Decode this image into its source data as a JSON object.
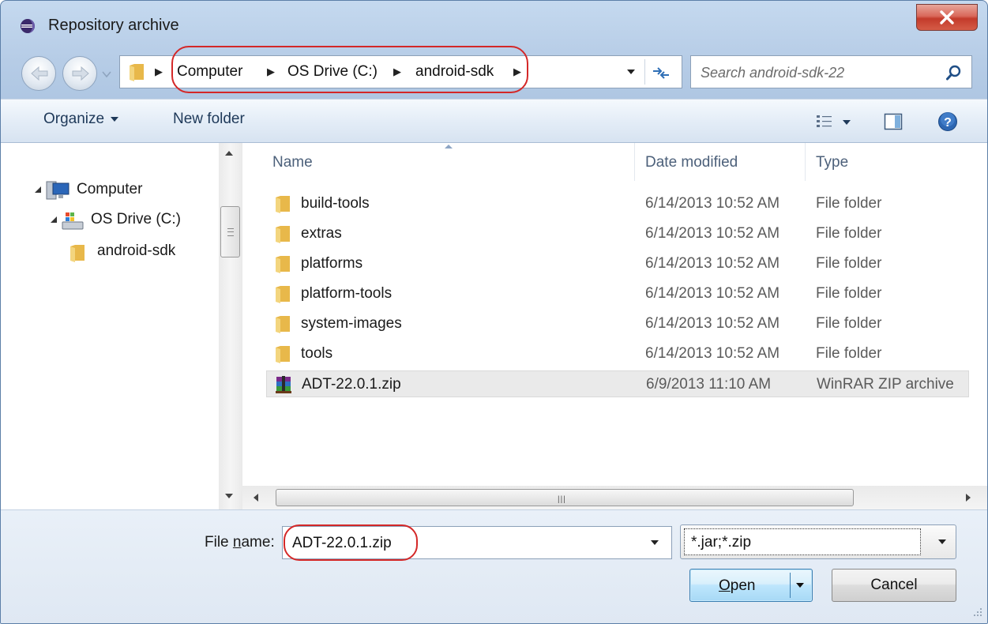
{
  "window": {
    "title": "Repository archive"
  },
  "address": {
    "crumbs": [
      "Computer",
      "OS Drive (C:)",
      "android-sdk"
    ]
  },
  "search": {
    "placeholder": "Search android-sdk-22"
  },
  "toolbar": {
    "organize_label": "Organize",
    "new_folder_label": "New folder"
  },
  "nav_tree": {
    "items": [
      {
        "label": "Computer"
      },
      {
        "label": "OS Drive (C:)"
      },
      {
        "label": "android-sdk"
      }
    ]
  },
  "columns": {
    "name": "Name",
    "date_modified": "Date modified",
    "type": "Type"
  },
  "files": [
    {
      "name": "build-tools",
      "date": "6/14/2013 10:52 AM",
      "type": "File folder",
      "icon": "folder-icon"
    },
    {
      "name": "extras",
      "date": "6/14/2013 10:52 AM",
      "type": "File folder",
      "icon": "folder-icon"
    },
    {
      "name": "platforms",
      "date": "6/14/2013 10:52 AM",
      "type": "File folder",
      "icon": "folder-icon"
    },
    {
      "name": "platform-tools",
      "date": "6/14/2013 10:52 AM",
      "type": "File folder",
      "icon": "folder-icon"
    },
    {
      "name": "system-images",
      "date": "6/14/2013 10:52 AM",
      "type": "File folder",
      "icon": "folder-icon"
    },
    {
      "name": "tools",
      "date": "6/14/2013 10:52 AM",
      "type": "File folder",
      "icon": "folder-icon"
    },
    {
      "name": "ADT-22.0.1.zip",
      "date": "6/9/2013 11:10 AM",
      "type": "WinRAR ZIP archive",
      "icon": "winrar-archive-icon",
      "selected": true
    }
  ],
  "bottom": {
    "file_name_label_pre": "File ",
    "file_name_label_u": "n",
    "file_name_label_post": "ame:",
    "file_name_value": "ADT-22.0.1.zip",
    "filter_value": "*.jar;*.zip",
    "open_label_u": "O",
    "open_label_rest": "pen",
    "cancel_label": "Cancel"
  },
  "colors": {
    "highlight": "#d42828",
    "title_bar": "#c5d9ef",
    "close_button": "#c33b2b",
    "open_button": "#bee6fd",
    "folder": "#e8b84a"
  }
}
